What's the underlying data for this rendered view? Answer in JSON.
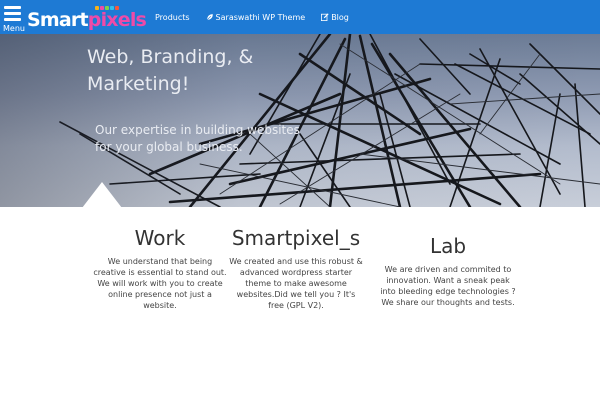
{
  "nav": {
    "menu_label": "Menu",
    "logo": {
      "smart": "Smart",
      "pixels": "pixels",
      "smart_color": "#ffffff",
      "pixels_color": "#ef4aa8"
    },
    "links": [
      {
        "label": "Products",
        "icon": ""
      },
      {
        "label": "Saraswathi WP Theme",
        "icon": "leaf-icon"
      },
      {
        "label": "Blog",
        "icon": "edit-icon"
      }
    ],
    "bar_color": "#1e7ad4"
  },
  "hero": {
    "heading": "Web, Branding, & Marketing!",
    "subtitle": "Our expertise in building websites for your global business."
  },
  "features": [
    {
      "title": "Work",
      "text": "We understand that being creative is essential to stand out. We will work with you to create online presence not just a website."
    },
    {
      "title": "Smartpixel_s",
      "text": "We created and use this robust & advanced wordpress starter theme to make awesome websites.Did we tell you ? It's free (GPL V2)."
    },
    {
      "title": "Lab",
      "text": "We are driven and commited to innovation. Want a sneak peak into bleeding edge technologies ? We share our thoughts and tests."
    }
  ]
}
